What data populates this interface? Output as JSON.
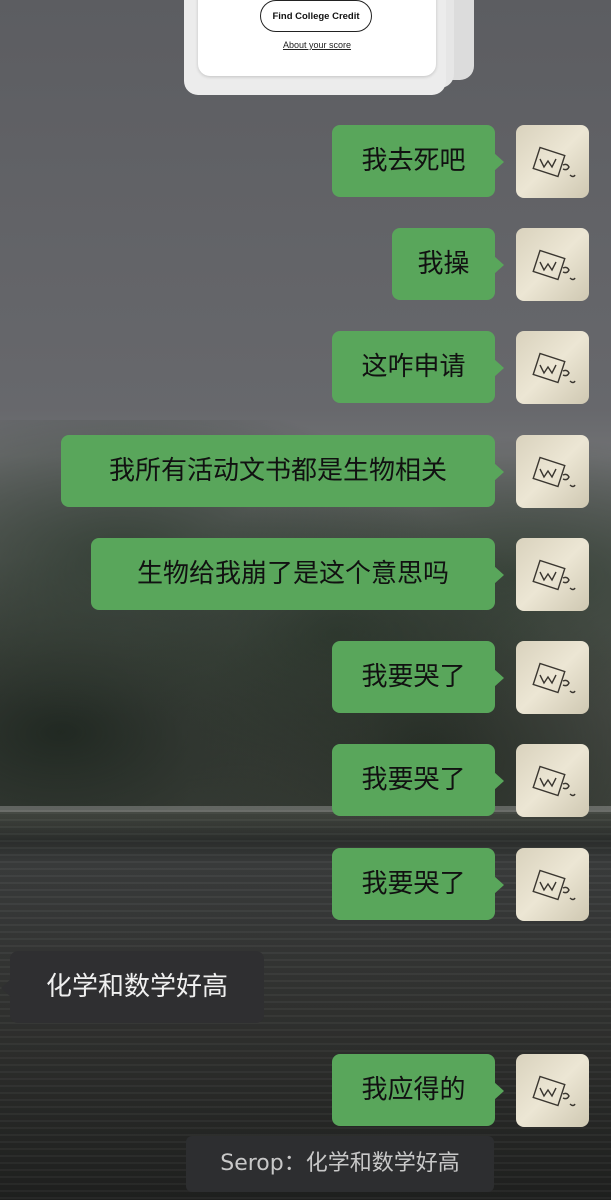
{
  "score_card": {
    "find_button_label": "Find College Credit",
    "about_link_label": "About your score"
  },
  "messages": [
    {
      "side": "sent",
      "text": "我去死吧"
    },
    {
      "side": "sent",
      "text": "我操"
    },
    {
      "side": "sent",
      "text": "这咋申请"
    },
    {
      "side": "sent",
      "text": "我所有活动文书都是生物相关"
    },
    {
      "side": "sent",
      "text": "生物给我崩了是这个意思吗"
    },
    {
      "side": "sent",
      "text": "我要哭了"
    },
    {
      "side": "sent",
      "text": "我要哭了"
    },
    {
      "side": "sent",
      "text": "我要哭了"
    },
    {
      "side": "received",
      "text": "化学和数学好高"
    },
    {
      "side": "sent",
      "text": "我应得的"
    }
  ],
  "quote": {
    "text": "Serop：化学和数学好高"
  },
  "avatar": {
    "icon": "sketch-avatar-icon"
  },
  "colors": {
    "sent_bubble": "#59a65b",
    "received_bubble": "#2f2f31"
  }
}
